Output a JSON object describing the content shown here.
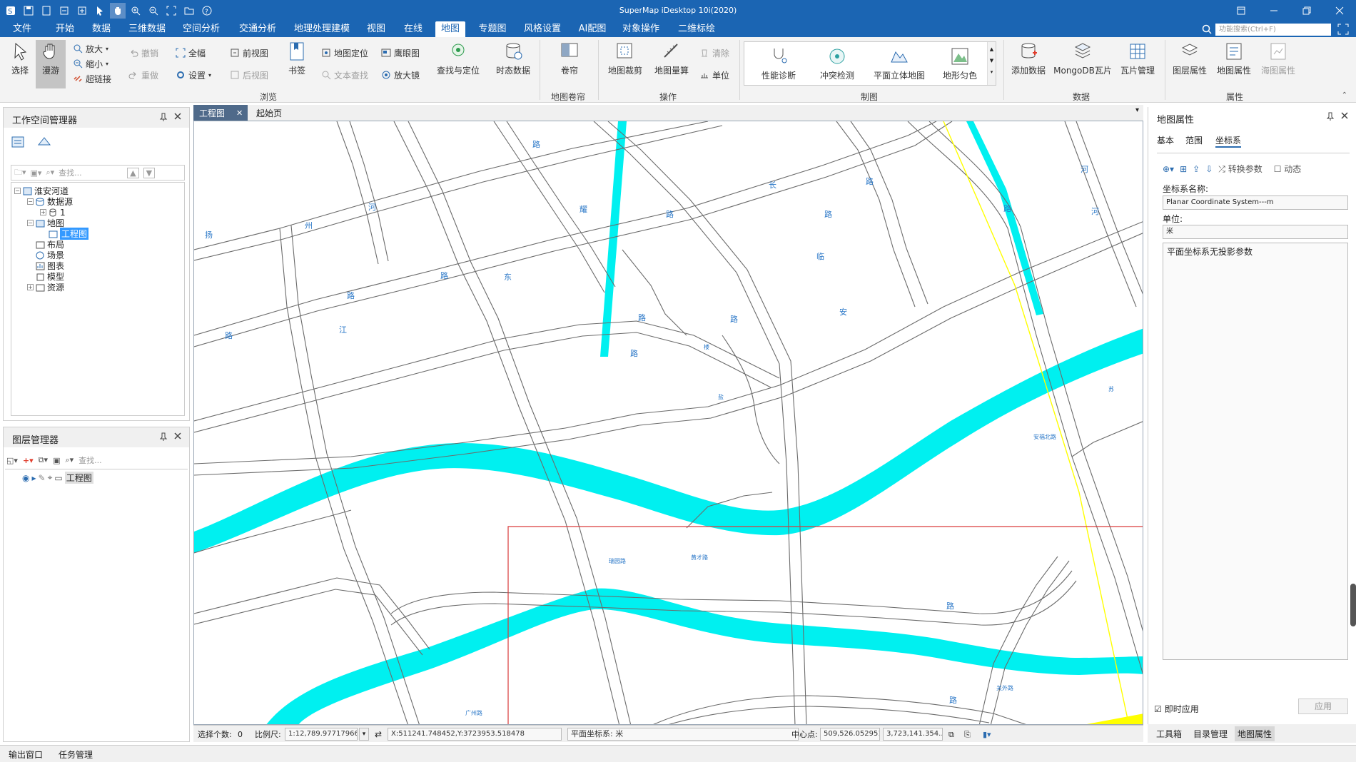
{
  "app": {
    "title": "SuperMap iDesktop 10i(2020)"
  },
  "colors": {
    "accent": "#1b65b3",
    "water": "#00f0f0",
    "road": "#707070",
    "highlight": "#ffff00",
    "frame": "#d93a3a"
  },
  "menu": {
    "tabs": [
      "文件",
      "开始",
      "数据",
      "三维数据",
      "空间分析",
      "交通分析",
      "地理处理建模",
      "视图",
      "在线",
      "地图",
      "专题图",
      "风格设置",
      "AI配图",
      "对象操作",
      "二维标绘"
    ],
    "active": "地图"
  },
  "search": {
    "placeholder": "功能搜索(Ctrl+F)"
  },
  "ribbon": {
    "browse": {
      "select": "选择",
      "pan": "漫游",
      "zoom_in": "放大",
      "zoom_out": "缩小",
      "hyperlink": "超链接",
      "undo": "撤销",
      "redo": "重做",
      "full": "全幅",
      "settings": "设置",
      "prev_view": "前视图",
      "next_view": "后视图",
      "bookmark": "书签",
      "locate": "地图定位",
      "text_search": "文本查找",
      "eagle": "鹰眼图",
      "magnifier": "放大镜",
      "find_locate": "查找与定位",
      "temporal": "时态数据",
      "group": "浏览"
    },
    "swipe": {
      "swipe": "卷帘",
      "group": "地图卷帘"
    },
    "ops": {
      "clip": "地图裁剪",
      "measure": "地图量算",
      "clear": "清除",
      "unit": "单位",
      "group": "操作"
    },
    "draw": {
      "perf": "性能诊断",
      "conflict": "冲突检测",
      "flat3d": "平面立体地图",
      "terrain": "地形匀色",
      "group": "制图"
    },
    "data": {
      "add": "添加数据",
      "mongo": "MongoDB瓦片",
      "tiles": "瓦片管理",
      "group": "数据"
    },
    "props": {
      "layer_props": "图层属性",
      "map_props": "地图属性",
      "chart_props": "海图属性",
      "group": "属性"
    }
  },
  "workspace": {
    "title": "工作空间管理器",
    "search_placeholder": "查找...",
    "tree": {
      "root": "淮安河道",
      "datasources": "数据源",
      "ds1": "1",
      "maps": "地图",
      "map1": "工程图",
      "layouts": "布局",
      "scenes": "场景",
      "charts": "图表",
      "models": "模型",
      "resources": "资源"
    }
  },
  "layers": {
    "title": "图层管理器",
    "search_placeholder": "查找...",
    "layer1": "工程图"
  },
  "doc_tabs": [
    {
      "label": "工程图"
    },
    {
      "label": "起始页"
    }
  ],
  "map": {
    "labels": [
      "路",
      "河",
      "扬",
      "州",
      "路",
      "东",
      "耀",
      "路",
      "长",
      "路",
      "临",
      "路",
      "路",
      "江",
      "路",
      "路",
      "路",
      "河",
      "河",
      "路",
      "路",
      "楼",
      "安",
      "路",
      "盐",
      "苏",
      "安福北路",
      "瑞园路",
      "黄才路",
      "广州路",
      "关外路",
      "路"
    ]
  },
  "status": {
    "selected_label": "选择个数:",
    "selected_count": "0",
    "scale_label": "比例尺:",
    "scale": "1:12,789.9771796676",
    "coords": "X:511241.748452,Y:3723953.518478",
    "crs": "平面坐标系: 米",
    "center_label": "中心点:",
    "center_x": "509,526.052951",
    "center_y": "3,723,141.354..."
  },
  "bottom": {
    "output": "输出窗口",
    "tasks": "任务管理"
  },
  "map_props": {
    "title": "地图属性",
    "tabs": [
      "基本",
      "范围",
      "坐标系"
    ],
    "convert": "转换参数",
    "dynamic": "动态",
    "crs_label": "坐标系名称:",
    "crs_name": "Planar Coordinate System---m",
    "unit_label": "单位:",
    "unit": "米",
    "params": "平面坐标系无投影参数",
    "instant": "即时应用",
    "apply": "应用"
  },
  "right_tabs": [
    "工具箱",
    "目录管理",
    "地图属性"
  ]
}
